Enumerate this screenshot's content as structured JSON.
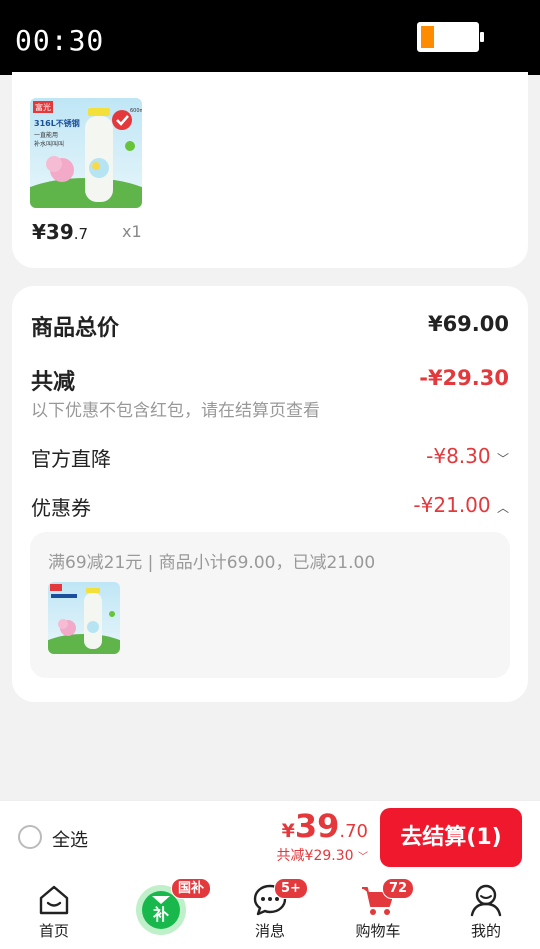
{
  "status_bar": {
    "time": "00:30"
  },
  "product": {
    "price_int": "¥39",
    "price_dec": ".7",
    "qty": "x1",
    "thumb_text": {
      "brand": "富光",
      "title": "316L不锈钢",
      "line1": "一直能用",
      "line2": "补水叫叫叫",
      "cap": "600ml"
    }
  },
  "summary": {
    "total_label": "商品总价",
    "total_value": "¥69.00",
    "discount_label": "共减",
    "discount_value": "-¥29.30",
    "discount_note": "以下优惠不包含红包，请在结算页查看",
    "official_label": "官方直降",
    "official_value": "-¥8.30",
    "coupon_label": "优惠券",
    "coupon_value": "-¥21.00",
    "coupon_detail": "满69减21元 | 商品小计69.00，已减21.00"
  },
  "bottom": {
    "select_all": "全选",
    "total_cur": "¥",
    "total_int": "39",
    "total_dec": ".70",
    "total_discount": "共减¥29.30",
    "checkout": "去结算(1)"
  },
  "tabs": [
    {
      "label": "首页"
    },
    {
      "label": "",
      "badge": "国补",
      "icon_text": "补"
    },
    {
      "label": "消息",
      "badge": "5+"
    },
    {
      "label": "购物车",
      "badge": "72"
    },
    {
      "label": "我的"
    }
  ],
  "colors": {
    "accent": "#e4393c",
    "checkout": "#f0182c",
    "battery": "#ff8c00"
  }
}
